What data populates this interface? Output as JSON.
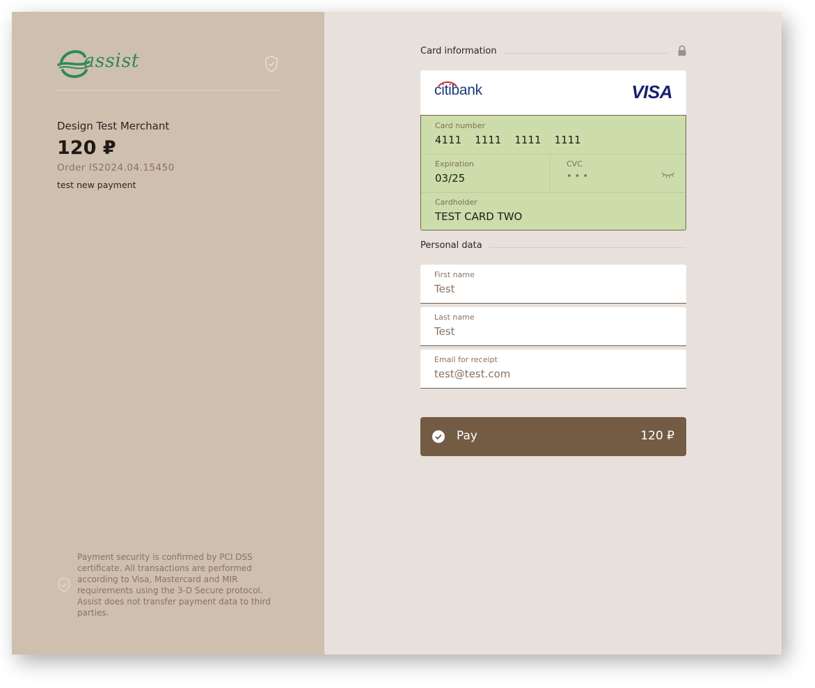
{
  "brand": {
    "logo_text": "assist",
    "logo_color": "#2e8a57"
  },
  "order": {
    "merchant": "Design Test Merchant",
    "amount": "120 ₽",
    "order_number": "Order IS2024.04.15450",
    "description": "test new payment"
  },
  "security_note": "Payment security is confirmed by PCI DSS certificate. All transactions are performed according to Visa, Mastercard and MIR requirements using the 3-D Secure protocol. Assist does not transfer payment data to third parties.",
  "card_section": {
    "title": "Card information",
    "bank": "citibank",
    "network": "VISA",
    "card_number_label": "Card number",
    "card_number": "4111  1111  1111  1111",
    "expiration_label": "Expiration",
    "expiration": "03/25",
    "cvc_label": "CVC",
    "cvc_masked": "•••",
    "cardholder_label": "Cardholder",
    "cardholder": "TEST CARD TWO"
  },
  "personal_section": {
    "title": "Personal data",
    "first_name_label": "First name",
    "first_name": "Test",
    "last_name_label": "Last name",
    "last_name": "Test",
    "email_label": "Email for receipt",
    "email": "test@test.com"
  },
  "pay_button": {
    "label": "Pay",
    "amount": "120 ₽",
    "color": "#735b44"
  },
  "colors": {
    "left_panel": "#cfbfaf",
    "right_panel": "#e8e0da",
    "card_fields": "#ccdcaa"
  },
  "icons": [
    "assist-logo-icon",
    "shield-icon",
    "lock-icon",
    "eye-closed-icon",
    "check-circle-icon"
  ]
}
